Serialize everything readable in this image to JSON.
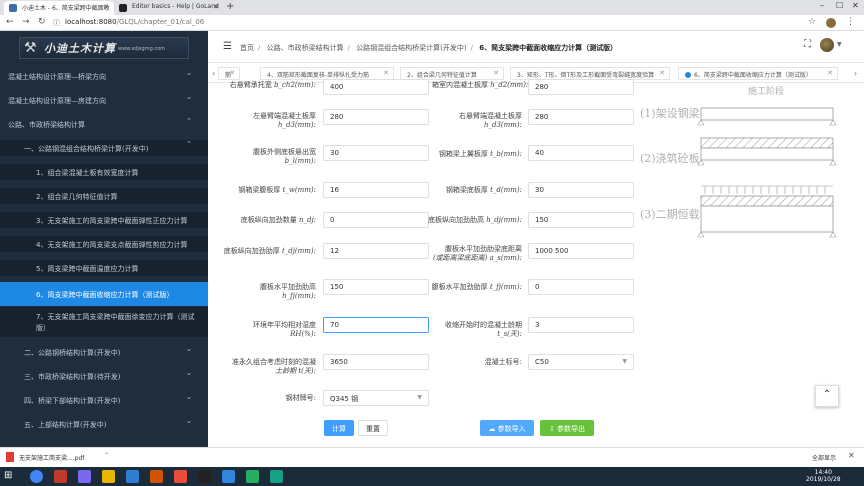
{
  "browser": {
    "tabs": [
      {
        "title": "小迪土木 - 6、简支梁跨中截面收",
        "active": true
      },
      {
        "title": "Editor basics - Help | GoLand",
        "active": false
      }
    ],
    "url_host": "localhost:8080",
    "url_path": "/GLQL/chapter_01/cal_06"
  },
  "logo": {
    "title": "小迪土木计算",
    "site": "www.xdjsgmg.com"
  },
  "sidebar": {
    "items": [
      {
        "label": "混凝土结构设计原理—桥梁方向",
        "level": 0,
        "chevron": "⌄"
      },
      {
        "label": "混凝土结构设计原理—房建方向",
        "level": 0,
        "chevron": "⌄"
      },
      {
        "label": "公路、市政桥梁结构计算",
        "level": 0,
        "chevron": "⌃"
      },
      {
        "label": "一、公路钢混组合结构桥梁计算(开发中)",
        "level": 1,
        "chevron": "⌃"
      },
      {
        "label": "1、组合梁混凝土板有效宽度计算",
        "level": 2,
        "chevron": ""
      },
      {
        "label": "2、组合梁几何特征值计算",
        "level": 2,
        "chevron": ""
      },
      {
        "label": "3、无支架施工的简支梁跨中截面弹性正应力计算",
        "level": 2,
        "chevron": ""
      },
      {
        "label": "4、无支架施工的简支梁支点截面弹性剪应力计算",
        "level": 2,
        "chevron": ""
      },
      {
        "label": "5、简支梁跨中截面温度应力计算",
        "level": 2,
        "chevron": ""
      },
      {
        "label": "6、简支梁跨中截面收缩应力计算（测试版）",
        "level": 2,
        "chevron": "",
        "active": true
      },
      {
        "label": "7、无支架施工简支梁跨中截面徐变应力计算（测试版）",
        "level": 2,
        "chevron": ""
      },
      {
        "label": "二、公路钢桥结构计算(开发中)",
        "level": 1,
        "chevron": "⌄"
      },
      {
        "label": "三、市政桥梁结构计算(待开发)",
        "level": 1,
        "chevron": "⌄"
      },
      {
        "label": "四、桥梁下部结构计算(开发中)",
        "level": 1,
        "chevron": "⌄"
      },
      {
        "label": "五、上部结构计算(开发中)",
        "level": 1,
        "chevron": "⌄"
      }
    ]
  },
  "header": {
    "breadcrumbs": [
      "首页",
      "公路、市政桥梁结构计算",
      "公路钢混组合结构桥梁计算(开发中)",
      "6、简支梁跨中截面收缩应力计算（测试版）"
    ]
  },
  "page_tabs": [
    {
      "label": "筋",
      "active": false
    },
    {
      "label": "4、双筋矩形截面复核-单排纵扎受力筋",
      "active": false
    },
    {
      "label": "2、组合梁几何特征值计算",
      "active": false
    },
    {
      "label": "3、矩形、T形、倒T形及工形截面受弯裂缝宽度验算",
      "active": false
    },
    {
      "label": "6、简支梁跨中截面收缩应力计算（测试版）",
      "active": true
    }
  ],
  "form": {
    "rows": [
      {
        "l_label": "右悬臂承托宽 ",
        "l_var": "b_ch2(mm):",
        "l_value": "400",
        "r_label": "箱室内混凝土板厚 ",
        "r_var": "h_d2(mm):",
        "r_value": "280"
      },
      {
        "l_label": "左悬臂端混凝土板厚",
        "l_var": "h_d3(mm):",
        "l_value": "280",
        "r_label": "右悬臂端混凝土板厚",
        "r_var": "h_d3(mm):",
        "r_value": "280"
      },
      {
        "l_label": "腹板外侧底板悬出宽",
        "l_var": "b_l(mm):",
        "l_value": "30",
        "r_label": "钢箱梁上翼板厚 ",
        "r_var": "t_b(mm):",
        "r_value": "40"
      },
      {
        "l_label": "钢箱梁腹板厚 ",
        "l_var": "t_w(mm):",
        "l_value": "16",
        "r_label": "钢箱梁底板厚 ",
        "r_var": "t_d(mm):",
        "r_value": "30"
      },
      {
        "l_label": "底板纵向加劲数量 ",
        "l_var": "n_dj:",
        "l_value": "0",
        "r_label": "底板纵向加劲肋高 ",
        "r_var": "h_dj(mm):",
        "r_value": "150"
      },
      {
        "l_label": "底板纵向加劲肋厚 ",
        "l_var": "t_dj(mm):",
        "l_value": "12",
        "r_label": "腹板水平加劲肋梁底距离",
        "r_var": "(或距离梁底距离) a_s(mm):",
        "r_value": "1000 500"
      },
      {
        "l_label": "腹板水平加劲肋高",
        "l_var": "h_fj(mm):",
        "l_value": "150",
        "r_label": "腹板水平加劲肋厚 ",
        "r_var": "t_fj(mm):",
        "r_value": "0"
      },
      {
        "l_label": "环境年平均相对湿度",
        "l_var": "RH(%):",
        "l_value": "70",
        "r_label": "收缩开始时的混凝土龄期",
        "r_var": "t_s(天):",
        "r_value": "3"
      },
      {
        "l_label": "准永久组合考虑时刻的混凝",
        "l_var": "土龄期 t(天):",
        "l_value": "3650",
        "r_label": "混凝土标号:",
        "r_var": "",
        "r_value": "C50"
      },
      {
        "l_label": "",
        "l_var": "钢材牌号:",
        "l_value": "Q345 钢",
        "r_label": "",
        "r_var": "",
        "r_value": ""
      }
    ],
    "buttons": {
      "calc": "计算",
      "reset": "重置",
      "import": "参数导入",
      "export": "参数导出"
    }
  },
  "diagram": {
    "top_text": "施工阶段",
    "labels": [
      "(1)架设钢梁",
      "(2)浇筑砼板",
      "(3)二期恒载"
    ]
  },
  "downloads": {
    "file": "无支架施工简支梁....pdf",
    "show_all": "全部显示"
  },
  "taskbar": {
    "time": "14:40",
    "date": "2019/10/28"
  }
}
